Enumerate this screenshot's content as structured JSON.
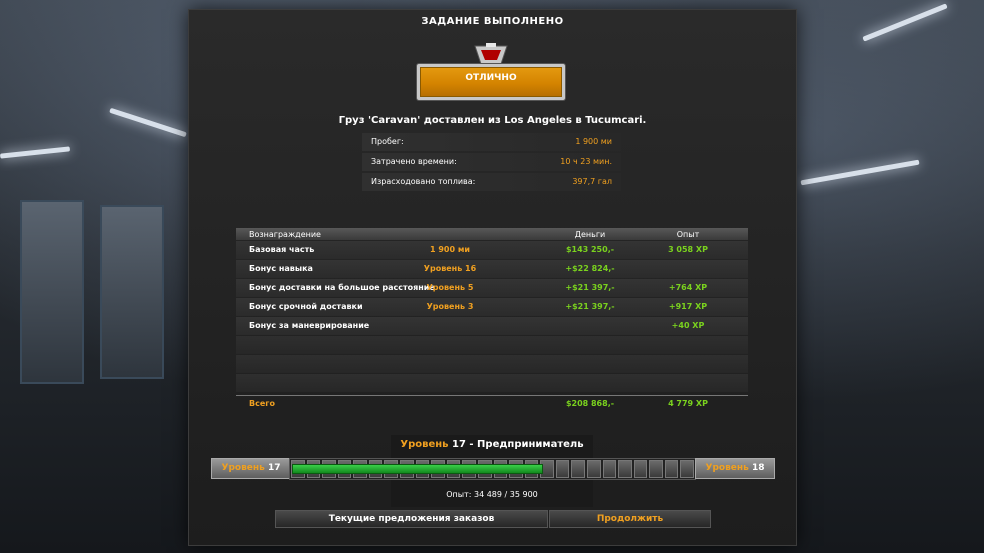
{
  "header": {
    "title": "ЗАДАНИЕ ВЫПОЛНЕНО"
  },
  "rating": {
    "label": "ОТЛИЧНО",
    "color": "#e09010"
  },
  "cargo_line": "Груз 'Caravan' доставлен из Los Angeles в Tucumcari.",
  "stats": [
    {
      "label": "Пробег:",
      "value": "1 900 ми"
    },
    {
      "label": "Затрачено времени:",
      "value": "10 ч 23 мин."
    },
    {
      "label": "Израсходовано топлива:",
      "value": "397,7 гал"
    }
  ],
  "rewards": {
    "headers": {
      "name": "Вознаграждение",
      "money": "Деньги",
      "xp": "Опыт"
    },
    "rows": [
      {
        "name": "Базовая часть",
        "value": "1 900 ми",
        "money": "$143 250,-",
        "xp": "3 058 XP"
      },
      {
        "name": "Бонус навыка",
        "value": "Уровень 16",
        "money": "+$22 824,-",
        "xp": ""
      },
      {
        "name": "Бонус доставки на большое расстояние",
        "value": "Уровень 5",
        "money": "+$21 397,-",
        "xp": "+764 XP"
      },
      {
        "name": "Бонус срочной доставки",
        "value": "Уровень 3",
        "money": "+$21 397,-",
        "xp": "+917 XP"
      },
      {
        "name": "Бонус за маневрирование",
        "value": "",
        "money": "",
        "xp": "+40 XP"
      }
    ],
    "total": {
      "name": "Всего",
      "money": "$208 868,-",
      "xp": "4 779 XP"
    }
  },
  "level": {
    "title_prefix": "Уровень",
    "title_number": "17",
    "title_rank": " - Предприниматель",
    "current_label": "Уровень",
    "current_num": "17",
    "next_label": "Уровень",
    "next_num": "18",
    "xp_text": "Опыт: 34 489 / 35 900",
    "progress_fraction": 0.62,
    "segments": 26
  },
  "buttons": {
    "offers": "Текущие предложения заказов",
    "continue": "Продолжить"
  },
  "colors": {
    "accent": "#f0a020",
    "money": "#7ad21e"
  }
}
